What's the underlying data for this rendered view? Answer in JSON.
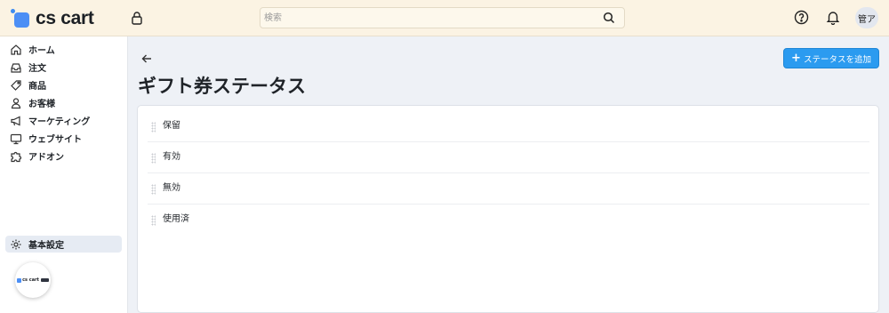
{
  "header": {
    "logo_text": "cs cart",
    "search_placeholder": "検索",
    "user_initials": "管ア"
  },
  "sidebar": {
    "items": [
      {
        "label": "ホーム",
        "icon": "home-icon"
      },
      {
        "label": "注文",
        "icon": "inbox-icon"
      },
      {
        "label": "商品",
        "icon": "tag-icon"
      },
      {
        "label": "お客様",
        "icon": "user-icon"
      },
      {
        "label": "マーケティング",
        "icon": "megaphone-icon"
      },
      {
        "label": "ウェブサイト",
        "icon": "monitor-icon"
      },
      {
        "label": "アドオン",
        "icon": "puzzle-icon"
      }
    ],
    "settings": {
      "label": "基本設定",
      "icon": "gear-icon"
    },
    "badge_text": "cs cart"
  },
  "main": {
    "title": "ギフト券ステータス",
    "add_button_label": "ステータスを追加",
    "statuses": [
      "保留",
      "有効",
      "無効",
      "使用済"
    ]
  },
  "colors": {
    "topbar": "#fbf3e3",
    "accent": "#2b9bf0",
    "brand": "#4c8ff5",
    "page_bg": "#eef1f6"
  }
}
